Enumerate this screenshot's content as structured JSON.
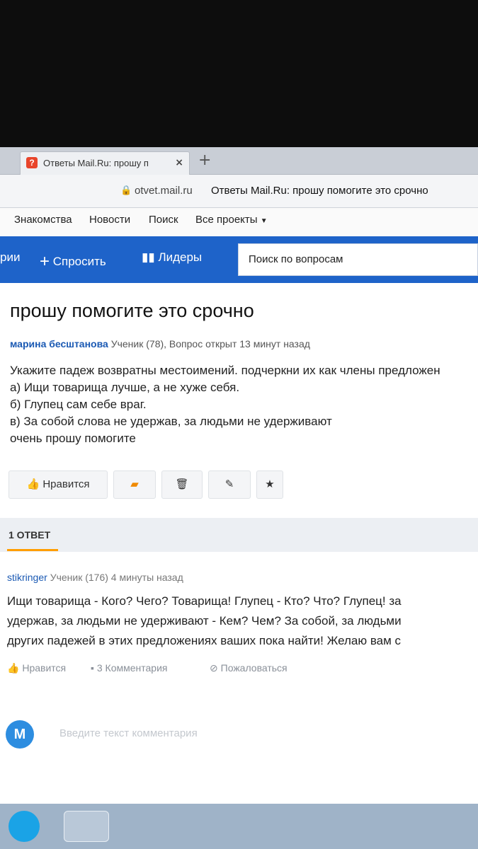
{
  "browser": {
    "tab_title": "Ответы Mail.Ru: прошу п",
    "tab_favicon": "?",
    "url": "otvet.mail.ru",
    "page_title": "Ответы Mail.Ru: прошу помогите это срочно"
  },
  "site_nav": [
    "Знакомства",
    "Новости",
    "Поиск",
    "Все проекты"
  ],
  "header": {
    "left_partial": "рии",
    "ask_label": "Спросить",
    "leaders_label": "Лидеры",
    "search_placeholder": "Поиск по вопросам"
  },
  "question": {
    "title": "прошу помогите это срочно",
    "author": "марина бесштанова",
    "meta": "Ученик (78), Вопрос открыт 13 минут назад",
    "lines": [
      "Укажите падеж возвратны местоимений. подчеркни их как члены предложен",
      "а) Ищи товарища лучше, а не хуже себя.",
      "б) Глупец сам себе враг.",
      "в) За собой слова не удержав, за людьми не удерживают",
      "очень прошу помогите"
    ],
    "like_label": "Нравится"
  },
  "answers": {
    "count_label": "1 ОТВЕТ",
    "items": [
      {
        "author": "stikringer",
        "meta": "Ученик (176) 4 минуты назад",
        "lines": [
          "Ищи товарища - Кого? Чего? Товарища! Глупец - Кто? Что? Глупец! за",
          "удержав, за людьми не удерживают - Кем? Чем? За собой, за людьми",
          "других падежей в этих предложениях ваших пока найти! Желаю вам с"
        ],
        "like_label": "Нравится",
        "comments_label": "3 Комментария",
        "report_label": "Пожаловаться"
      }
    ]
  },
  "comment_box": {
    "avatar_letter": "М",
    "placeholder": "Введите текст комментария"
  },
  "colors": {
    "brand_blue": "#1e63c9",
    "accent_orange": "#ff9e00",
    "link_blue": "#1a59b3"
  }
}
